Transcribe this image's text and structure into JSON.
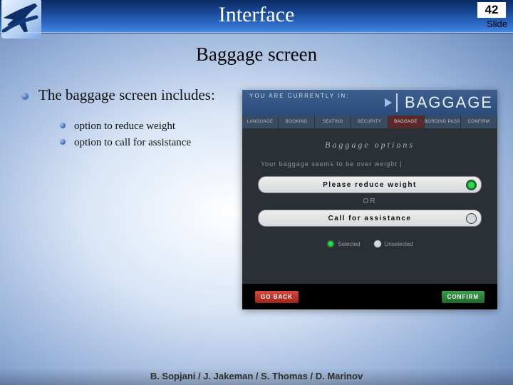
{
  "header": {
    "title": "Interface",
    "slide_number": "42",
    "slide_label": "Slide"
  },
  "subtitle": "Baggage screen",
  "body": {
    "lead": "The baggage screen includes:",
    "bullets": [
      "option to reduce weight",
      "option to call for assistance"
    ]
  },
  "kiosk": {
    "banner_label": "YOU  ARE  CURRENTLY  IN:",
    "banner_value": "BAGGAGE",
    "tabs": [
      "LANGUAGE",
      "BOOKING",
      "SEATING",
      "SECURITY",
      "BAGGAGE",
      "BORDING PASS",
      "CONFIRM"
    ],
    "active_tab_index": 4,
    "section_title": "Baggage   options",
    "status_message": "Your  baggage  seems  to  be  over  weight |",
    "options": [
      {
        "label": "Please  reduce  weight",
        "selected": true
      },
      {
        "label": "Call  for  assistance",
        "selected": false
      }
    ],
    "or_label": "OR",
    "legend_selected": "Selected",
    "legend_unselected": "Unselected",
    "btn_back": "GO BACK",
    "btn_confirm": "CONFIRM"
  },
  "credits": "B. Sopjani / J. Jakeman / S. Thomas / D. Marinov"
}
